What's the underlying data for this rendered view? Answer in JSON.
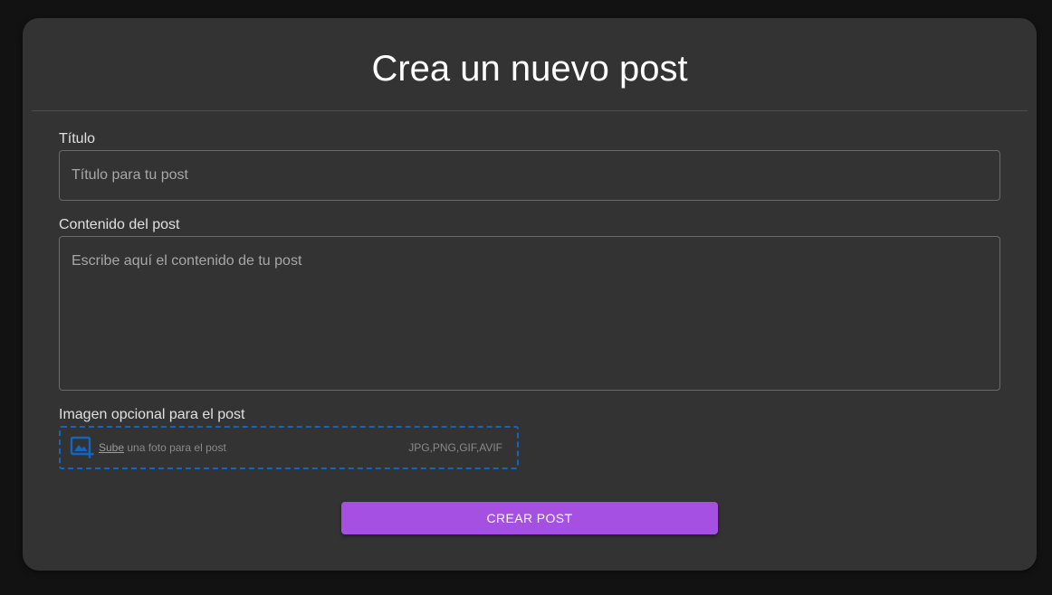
{
  "form": {
    "heading": "Crea un nuevo post",
    "title_field": {
      "label": "Título",
      "placeholder": "Título para tu post",
      "value": ""
    },
    "content_field": {
      "label": "Contenido del post",
      "placeholder": "Escribe aquí el contenido de tu post",
      "value": ""
    },
    "image_field": {
      "label": "Imagen opcional para el post",
      "upload_link": "Sube",
      "upload_text": " una foto para el post",
      "accepted_types": "JPG,PNG,GIF,AVIF",
      "icon": "add-photo-icon"
    },
    "submit_label": "CREAR POST"
  },
  "colors": {
    "background": "#121212",
    "card": "#333333",
    "accent": "#a550e0",
    "dropzone_border": "#1565c0"
  }
}
